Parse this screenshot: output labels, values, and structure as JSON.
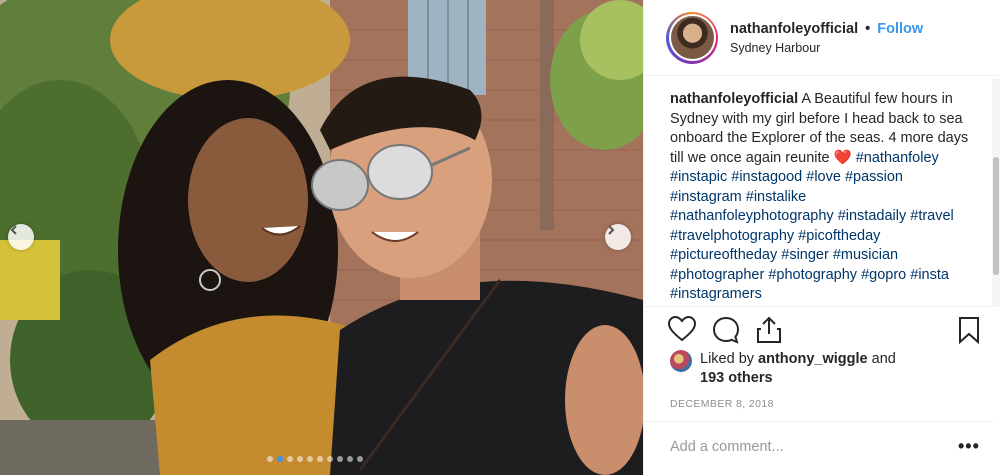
{
  "post": {
    "username": "nathanfoleyofficial",
    "separator": "•",
    "follow_label": "Follow",
    "location": "Sydney Harbour",
    "caption": {
      "username": "nathanfoleyofficial",
      "text": " A Beautiful few hours in Sydney with my girl before I head back to sea onboard the Explorer of the seas. 4 more days till we once again reunite ",
      "heart": "❤️",
      "hashtags": [
        "#nathanfoley",
        "#instapic",
        "#instagood",
        "#love",
        "#passion",
        "#instagram",
        "#instalike",
        "#nathanfoleyphotography",
        "#instadaily",
        "#travel",
        "#travelphotography",
        "#picoftheday",
        "#pictureoftheday",
        "#singer",
        "#musician",
        "#photographer",
        "#photography",
        "#gopro",
        "#insta",
        "#instagramers"
      ]
    },
    "likes": {
      "prefix": "Liked by",
      "user": "anthony_wiggle",
      "conjunction": "and",
      "others": "193 others"
    },
    "date": "DECEMBER 8, 2018",
    "comment_placeholder": "Add a comment...",
    "more_label": "•••",
    "carousel": {
      "total": 10,
      "active_index": 1
    }
  },
  "icons": {
    "like": "heart-outline-icon",
    "comment": "speech-bubble-icon",
    "share": "share-upload-icon",
    "save": "bookmark-icon",
    "prev": "chevron-left-icon",
    "next": "chevron-right-icon"
  },
  "colors": {
    "link_blue": "#3897f0",
    "hashtag": "#003569",
    "muted": "#8e8e8e",
    "text": "#262626"
  }
}
